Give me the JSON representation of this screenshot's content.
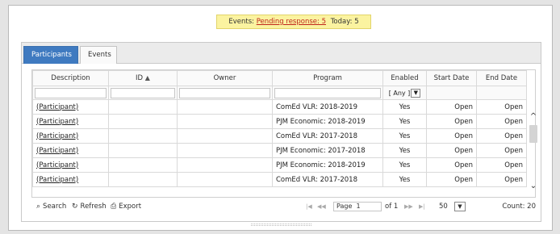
{
  "banner": {
    "prefix": "Events:",
    "pending": "Pending response: 5",
    "today": "Today: 5"
  },
  "tabs": [
    {
      "label": "Participants",
      "active": true
    },
    {
      "label": "Events",
      "active": false
    }
  ],
  "grid": {
    "columns": [
      "Description",
      "ID",
      "Owner",
      "Program",
      "Enabled",
      "Start Date",
      "End Date"
    ],
    "sort_icon": "sort-asc-icon",
    "enabled_filter": "[ Any ]",
    "rows": [
      {
        "description": "(Participant)",
        "id": "",
        "owner": "",
        "program": "ComEd VLR: 2018-2019",
        "enabled": "Yes",
        "start": "Open",
        "end": "Open"
      },
      {
        "description": "(Participant)",
        "id": "",
        "owner": "",
        "program": "PJM Economic: 2018-2019",
        "enabled": "Yes",
        "start": "Open",
        "end": "Open"
      },
      {
        "description": "(Participant)",
        "id": "",
        "owner": "",
        "program": "ComEd VLR: 2017-2018",
        "enabled": "Yes",
        "start": "Open",
        "end": "Open"
      },
      {
        "description": "(Participant)",
        "id": "",
        "owner": "",
        "program": "PJM Economic: 2017-2018",
        "enabled": "Yes",
        "start": "Open",
        "end": "Open"
      },
      {
        "description": "(Participant)",
        "id": "",
        "owner": "",
        "program": "PJM Economic: 2018-2019",
        "enabled": "Yes",
        "start": "Open",
        "end": "Open"
      },
      {
        "description": "(Participant)",
        "id": "",
        "owner": "",
        "program": "ComEd VLR: 2017-2018",
        "enabled": "Yes",
        "start": "Open",
        "end": "Open"
      }
    ]
  },
  "pager": {
    "search": "Search",
    "refresh": "Refresh",
    "export": "Export",
    "page_label": "Page",
    "page_value": "1",
    "of_label": "of 1",
    "page_size": "50",
    "count": "Count: 20"
  },
  "colors": {
    "tab_active": "#3f7ac0",
    "banner_bg": "#fbf3a0",
    "pending_link": "#c0261c"
  }
}
